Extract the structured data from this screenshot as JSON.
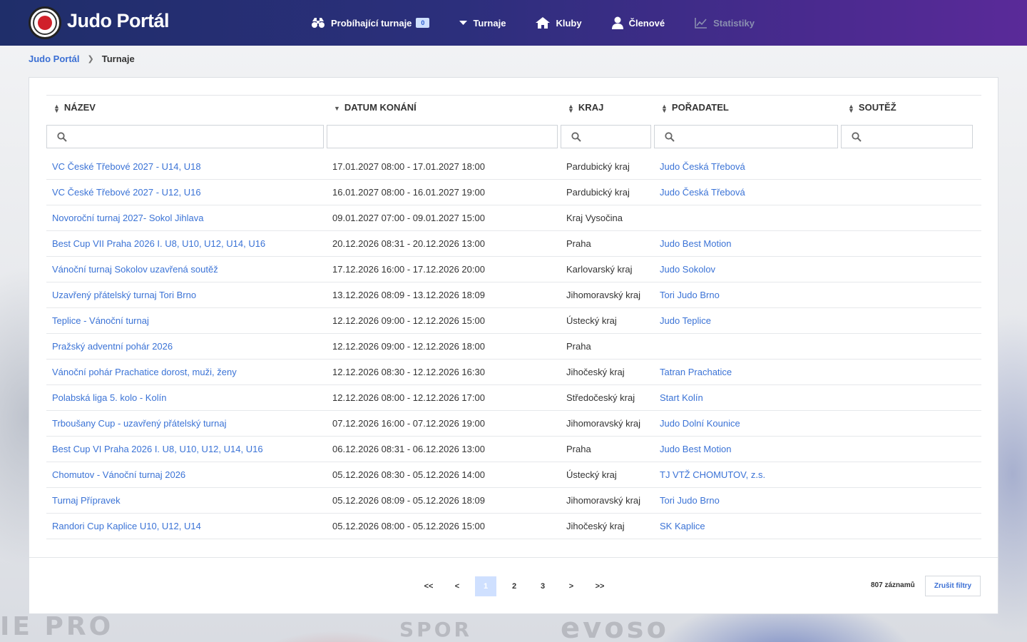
{
  "app": {
    "title": "Judo Portál"
  },
  "nav": [
    {
      "label": "Probíhající turnaje",
      "icon": "binoculars-icon",
      "badge": "0",
      "disabled": false
    },
    {
      "label": "Turnaje",
      "icon": "caret-down-icon",
      "disabled": false
    },
    {
      "label": "Kluby",
      "icon": "home-icon",
      "disabled": false
    },
    {
      "label": "Členové",
      "icon": "user-icon",
      "disabled": false
    },
    {
      "label": "Statistiky",
      "icon": "chart-line-icon",
      "disabled": true
    }
  ],
  "breadcrumb": {
    "home": "Judo Portál",
    "current": "Turnaje"
  },
  "table": {
    "columns": [
      "Název",
      "Datum konání",
      "Kraj",
      "Pořadatel",
      "Soutěž"
    ],
    "rows": [
      {
        "name": "VC České Třebové 2027 - U14, U18",
        "date": "17.01.2027 08:00 - 17.01.2027 18:00",
        "region": "Pardubický kraj",
        "organizer": "Judo Česká Třebová",
        "competition": ""
      },
      {
        "name": "VC České Třebové 2027 - U12, U16",
        "date": "16.01.2027 08:00 - 16.01.2027 19:00",
        "region": "Pardubický kraj",
        "organizer": "Judo Česká Třebová",
        "competition": ""
      },
      {
        "name": "Novoroční turnaj 2027- Sokol Jihlava",
        "date": "09.01.2027 07:00 - 09.01.2027 15:00",
        "region": "Kraj Vysočina",
        "organizer": "",
        "competition": ""
      },
      {
        "name": "Best Cup VII Praha 2026 I. U8, U10, U12, U14, U16",
        "date": "20.12.2026 08:31 - 20.12.2026 13:00",
        "region": "Praha",
        "organizer": "Judo Best Motion",
        "competition": ""
      },
      {
        "name": "Vánoční turnaj Sokolov uzavřená soutěž",
        "date": "17.12.2026 16:00 - 17.12.2026 20:00",
        "region": "Karlovarský kraj",
        "organizer": "Judo Sokolov",
        "competition": ""
      },
      {
        "name": "Uzavřený přátelský turnaj Tori Brno",
        "date": "13.12.2026 08:09 - 13.12.2026 18:09",
        "region": "Jihomoravský kraj",
        "organizer": "Tori Judo Brno",
        "competition": ""
      },
      {
        "name": "Teplice - Vánoční turnaj",
        "date": "12.12.2026 09:00 - 12.12.2026 15:00",
        "region": "Ústecký kraj",
        "organizer": "Judo Teplice",
        "competition": ""
      },
      {
        "name": "Pražský adventní pohár 2026",
        "date": "12.12.2026 09:00 - 12.12.2026 18:00",
        "region": "Praha",
        "organizer": "",
        "competition": ""
      },
      {
        "name": "Vánoční pohár Prachatice dorost, muži, ženy",
        "date": "12.12.2026 08:30 - 12.12.2026 16:30",
        "region": "Jihočeský kraj",
        "organizer": "Tatran Prachatice",
        "competition": ""
      },
      {
        "name": "Polabská liga 5. kolo - Kolín",
        "date": "12.12.2026 08:00 - 12.12.2026 17:00",
        "region": "Středočeský kraj",
        "organizer": "Start Kolín",
        "competition": ""
      },
      {
        "name": "Trboušany Cup - uzavřený přátelský turnaj",
        "date": "07.12.2026 16:00 - 07.12.2026 19:00",
        "region": "Jihomoravský kraj",
        "organizer": "Judo Dolní Kounice",
        "competition": ""
      },
      {
        "name": "Best Cup VI Praha 2026 I. U8, U10, U12, U14, U16",
        "date": "06.12.2026 08:31 - 06.12.2026 13:00",
        "region": "Praha",
        "organizer": "Judo Best Motion",
        "competition": ""
      },
      {
        "name": "Chomutov - Vánoční turnaj 2026",
        "date": "05.12.2026 08:30 - 05.12.2026 14:00",
        "region": "Ústecký kraj",
        "organizer": "TJ VTŽ CHOMUTOV, z.s.",
        "competition": ""
      },
      {
        "name": "Turnaj Přípravek",
        "date": "05.12.2026 08:09 - 05.12.2026 18:09",
        "region": "Jihomoravský kraj",
        "organizer": "Tori Judo Brno",
        "competition": ""
      },
      {
        "name": "Randori Cup Kaplice U10, U12, U14",
        "date": "05.12.2026 08:00 - 05.12.2026 15:00",
        "region": "Jihočeský kraj",
        "organizer": "SK Kaplice",
        "competition": ""
      }
    ]
  },
  "pagination": {
    "first": "<<",
    "prev": "<",
    "pages": [
      "1",
      "2",
      "3"
    ],
    "current": "1",
    "next": ">",
    "last": ">>",
    "count": "807 záznamů",
    "reset": "Zrušit filtry"
  },
  "colors": {
    "header_start": "#1f2e6a",
    "header_end": "#5a2a99",
    "link": "#3b73d6",
    "badge_bg": "#cfe0ff"
  }
}
